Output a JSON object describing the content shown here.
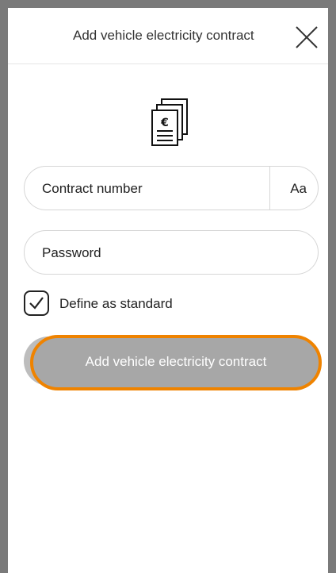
{
  "header": {
    "title": "Add vehicle electricity contract"
  },
  "form": {
    "contract_number_placeholder": "Contract number",
    "keyboard_toggle_label": "Aa",
    "password_placeholder": "Password",
    "define_standard_label": "Define as standard",
    "define_standard_checked": true,
    "submit_label": "Add vehicle electricity contract"
  },
  "icons": {
    "close": "close-icon",
    "document": "euro-document-icon",
    "check": "checkmark-icon"
  },
  "colors": {
    "accent_outline": "#ef8300",
    "button_disabled": "#a7a7a7"
  }
}
